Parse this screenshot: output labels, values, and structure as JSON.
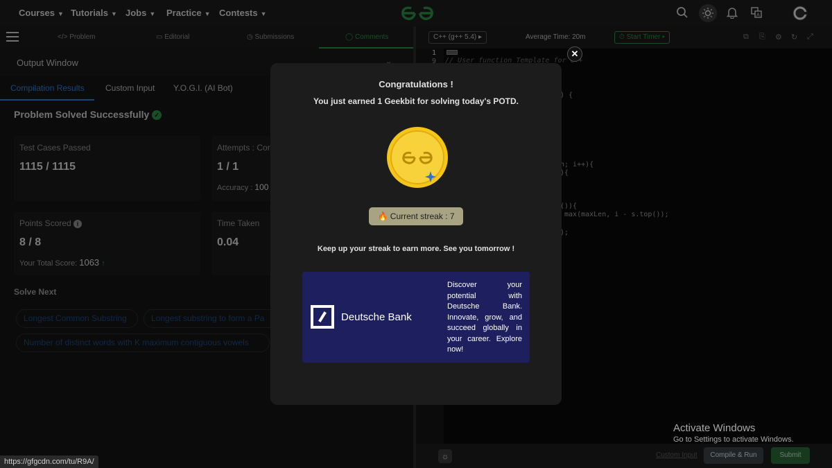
{
  "nav": {
    "items": [
      "Courses",
      "Tutorials",
      "Jobs",
      "Practice",
      "Contests"
    ]
  },
  "problem_tabs": {
    "problem": "Problem",
    "editorial": "Editorial",
    "submissions": "Submissions",
    "comments": "Comments"
  },
  "output": {
    "title": "Output Window",
    "tabs": [
      "Compilation Results",
      "Custom Input",
      "Y.O.G.I. (AI Bot)"
    ],
    "status": "Problem Solved Successfully",
    "test_cases_label": "Test Cases Passed",
    "test_cases_value": "1115 / 1115",
    "attempts_label": "Attempts : Corr",
    "attempts_value": "1 / 1",
    "accuracy_label": "Accuracy :",
    "accuracy_value": "100",
    "points_label": "Points Scored",
    "points_value": "8 / 8",
    "total_score_label": "Your Total Score:",
    "total_score_value": "1063",
    "time_label": "Time Taken",
    "time_value": "0.04",
    "solve_next_label": "Solve Next",
    "solve_next": [
      "Longest Common Substring",
      "Longest substring to form a Pa",
      "Number of distinct words with K maximum contiguous vowels"
    ]
  },
  "editor": {
    "language": "C++ (g++ 5.4)",
    "avg_time": "Average Time: 20m",
    "timer_label": "Start Timer",
    "line_numbers": [
      "1",
      "9"
    ],
    "code_lines": [
      "// User function Template for C++",
      ") {",
      "n; i++){",
      "){",
      "()){",
      " max(maxLen, i - s.top());",
      ");"
    ]
  },
  "bottom": {
    "custom_input": "Custom Input",
    "compile_run": "Compile & Run",
    "submit": "Submit"
  },
  "modal": {
    "title": "Congratulations !",
    "subtitle": "You just earned 1 Geekbit for solving today's POTD.",
    "streak": "Current streak : 7 days",
    "message": "Keep up your streak to earn more. See you tomorrow !",
    "close": "✕",
    "ad_brand": "Deutsche Bank",
    "ad_text": "Discover your potential with Deutsche Bank. Innovate, grow, and succeed globally in your career. Explore now!"
  },
  "system": {
    "status_url": "https://gfgcdn.com/tu/R9A/",
    "activate_title": "Activate Windows",
    "activate_sub": "Go to Settings to activate Windows."
  },
  "colors": {
    "accent_green": "#2f8d46",
    "tab_blue": "#2d7fe0",
    "link_blue": "#1e4a82",
    "coin_gold": "#f5c518",
    "ad_navy": "#1d1f5e"
  }
}
